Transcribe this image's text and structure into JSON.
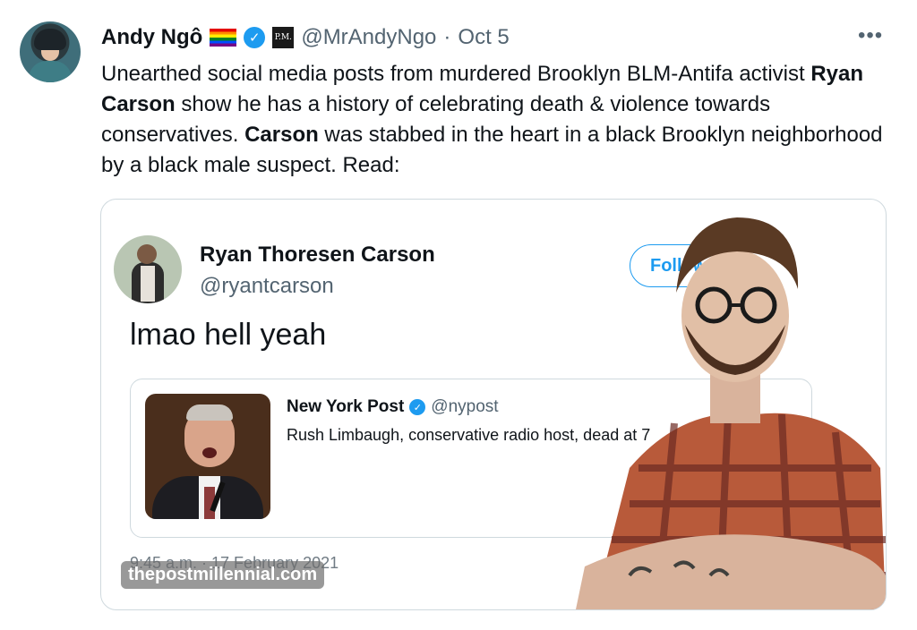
{
  "tweet": {
    "author_name": "Andy Ngô",
    "handle": "@MrAndyNgo",
    "separator": "·",
    "date": "Oct 5",
    "badge_text": "P.M.",
    "more": "•••",
    "text": {
      "p1": "Unearthed social media posts from murdered Brooklyn BLM-Antifa activist ",
      "b1": "Ryan Carson",
      "p2": " show he has a history of celebrating death & violence towards conservatives. ",
      "b2": "Carson",
      "p3": " was stabbed in the heart in a black Brooklyn neighborhood by a black male suspect. Read:"
    }
  },
  "embedded": {
    "name": "Ryan Thoresen Carson",
    "handle": "@ryantcarson",
    "follow_label": "Follow",
    "text": "lmao hell yeah",
    "timestamp": "9:45 a.m. · 17 February 2021",
    "watermark": "thepostmillennial.com",
    "quoted": {
      "name": "New York Post",
      "handle": "@nypost",
      "text": "Rush Limbaugh, conservative radio host, dead at 7"
    }
  },
  "colors": {
    "verified_blue": "#1d9bf0",
    "muted_text": "#536471",
    "border": "#cfd9de"
  }
}
